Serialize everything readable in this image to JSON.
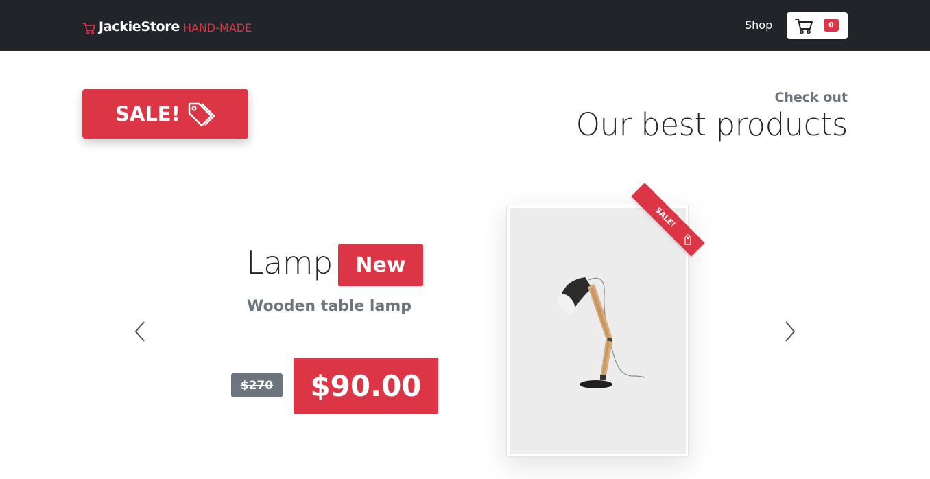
{
  "navbar": {
    "brand_name": "JackieStore",
    "brand_tag": "HAND-MADE",
    "shop_link": "Shop",
    "cart_count": "0"
  },
  "sale_banner": {
    "label": "SALE!"
  },
  "heading": {
    "kicker": "Check out",
    "title": "Our best products"
  },
  "product": {
    "name": "Lamp",
    "badge": "New",
    "description": "Wooden table lamp",
    "old_price": "$270",
    "price": "$90.00",
    "ribbon": "SALE!"
  },
  "colors": {
    "accent": "#dc3545",
    "navbar": "#212429",
    "muted": "#6c757d"
  },
  "icons": [
    "shopping-cart-icon",
    "tags-icon",
    "chevron-left-icon",
    "chevron-right-icon",
    "price-tag-icon"
  ]
}
